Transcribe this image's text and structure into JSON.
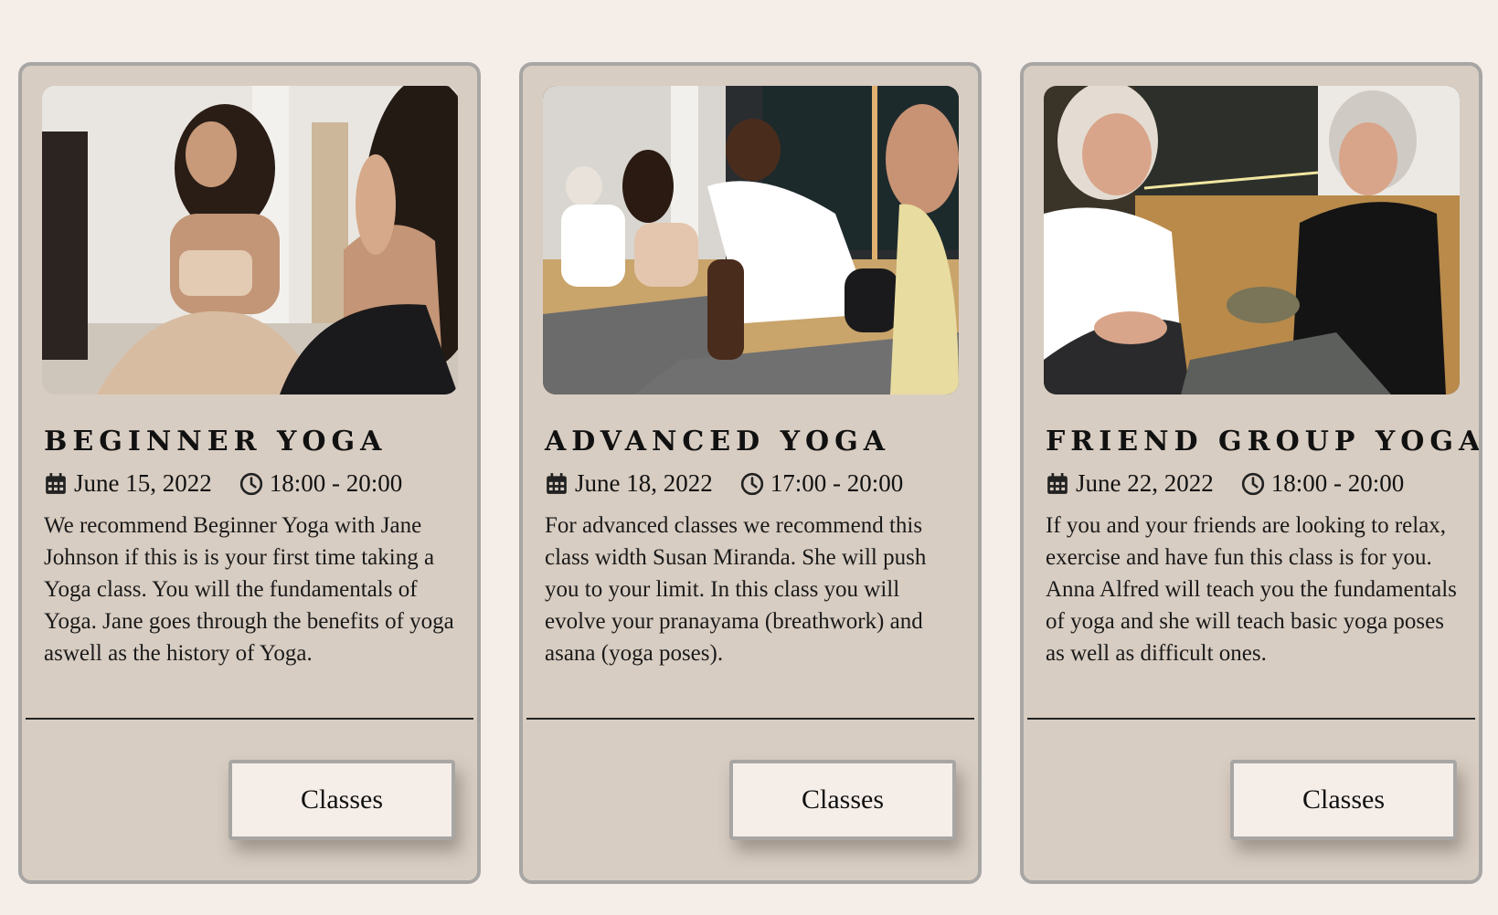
{
  "colors": {
    "page_background": "#f5ede8",
    "card_background": "#d8cdc2",
    "card_border": "#a8a6a4",
    "button_background": "#f5ede8"
  },
  "cards": [
    {
      "title": "BEGINNER YOGA",
      "date": "June 15, 2022",
      "time": "18:00 - 20:00",
      "description": "We recommend Beginner Yoga with Jane Johnson if this is is your first time taking a Yoga class. You will the fundamentals of Yoga. Jane goes through the benefits of yoga aswell as the history of Yoga.",
      "button_label": "Classes",
      "date_icon": "calendar-icon",
      "time_icon": "clock-icon"
    },
    {
      "title": "ADVANCED YOGA",
      "date": "June 18, 2022",
      "time": "17:00 - 20:00",
      "description": "For advanced classes we recommend this class width Susan Miranda. She will push you to your limit. In this class you will evolve your pranayama (breathwork) and asana (yoga poses).",
      "button_label": "Classes",
      "date_icon": "calendar-icon",
      "time_icon": "clock-icon"
    },
    {
      "title": "FRIEND GROUP YOGA",
      "date": "June 22, 2022",
      "time": "18:00 - 20:00",
      "description": "If you and your friends are looking to relax, exercise and have fun this class is for you. Anna Alfred will teach you the fundamentals of yoga and she will teach basic yoga poses as well as difficult ones.",
      "button_label": "Classes",
      "date_icon": "calendar-icon",
      "time_icon": "clock-icon"
    }
  ]
}
